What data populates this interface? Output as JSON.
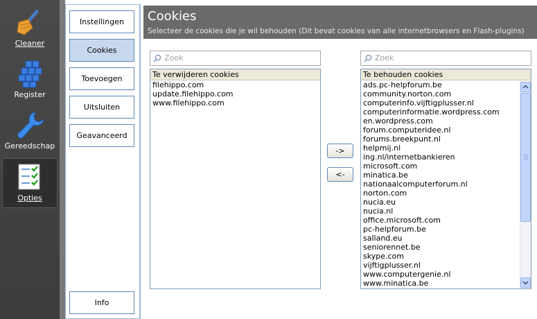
{
  "sidebar": {
    "items": [
      {
        "label": "Cleaner",
        "icon": "broom-icon"
      },
      {
        "label": "Register",
        "icon": "registry-cubes-icon"
      },
      {
        "label": "Gereedschap",
        "icon": "wrench-icon"
      },
      {
        "label": "Opties",
        "icon": "checklist-icon"
      }
    ]
  },
  "nav": {
    "instellingen": "Instellingen",
    "cookies": "Cookies",
    "toevoegen": "Toevoegen",
    "uitsluiten": "Uitsluiten",
    "geavanceerd": "Geavanceerd",
    "info": "Info"
  },
  "header": {
    "title": "Cookies",
    "subtitle": "Selecteer de cookies die je wil behouden (Dit bevat cookies van alle internetbrowsers en Flash-plugins)"
  },
  "left": {
    "search_placeholder": "Zoek",
    "header": "Te verwijderen cookies",
    "items": [
      "filehippo.com",
      "update.filehippo.com",
      "www.filehippo.com"
    ]
  },
  "right": {
    "search_placeholder": "Zoek",
    "header": "Te behouden cookies",
    "items": [
      "ads.pc-helpforum.be",
      "community.norton.com",
      "computerinfo.vijftigplusser.nl",
      "computerinformatie.wordpress.com",
      "en.wordpress.com",
      "forum.computeridee.nl",
      "forums.breekpunt.nl",
      "helpmij.nl",
      "ing.nl/internetbankieren",
      "microsoft.com",
      "minatica.be",
      "nationaalcomputerforum.nl",
      "norton.com",
      "nucia.eu",
      "nucia.nl",
      "office.microsoft.com",
      "pc-helpforum.be",
      "salland.eu",
      "seniorennet.be",
      "skype.com",
      "vijftigplusser.nl",
      "www.computergenie.nl",
      "www.minatica.be"
    ]
  },
  "buttons": {
    "move_right": "->",
    "move_left": "<-"
  },
  "colors": {
    "sidebar": "#444444",
    "header": "#6a6a6a",
    "accent": "#5b86b6",
    "active_nav": "#c7d8ee"
  }
}
